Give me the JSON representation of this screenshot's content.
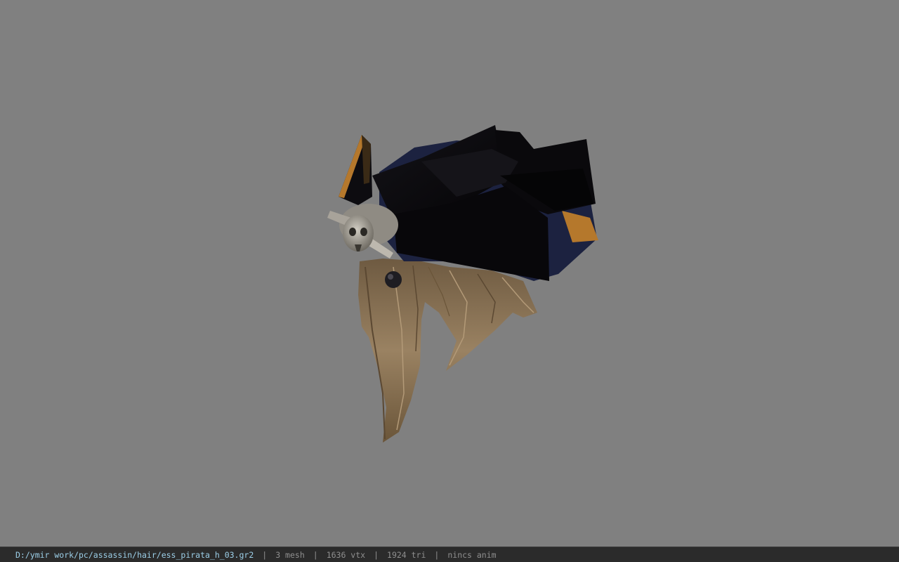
{
  "viewer": {
    "background_color": "#808080",
    "model": {
      "label": "pirate hat with skull emblem and long hair",
      "colors": {
        "hat": "#0b0a0d",
        "hat_trim": "#b5782c",
        "hat_side": "#1c2240",
        "skull": "#a8a39a",
        "hair": "#8a7457"
      }
    }
  },
  "status_bar": {
    "file_path": "D:/ymir work/pc/assassin/hair/ess_pirata_h_03.gr2",
    "separator": "|",
    "mesh_count": "3 mesh",
    "vertex_count": "1636 vtx",
    "triangle_count": "1924 tri",
    "anim_status": "nincs anim",
    "path_color": "#9ccfe8",
    "text_color": "#8f8f8f"
  }
}
